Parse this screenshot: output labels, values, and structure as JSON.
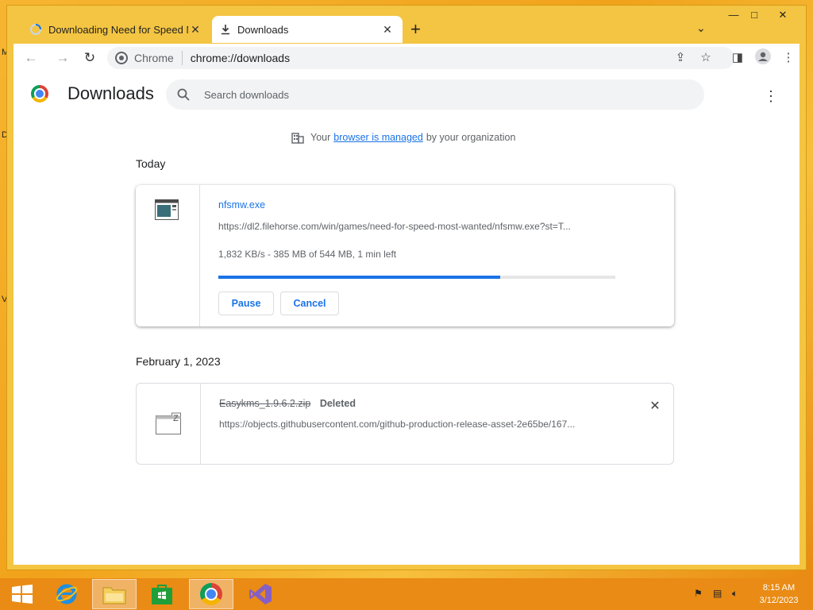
{
  "desktop": {
    "letters": [
      "M",
      "D",
      "V"
    ]
  },
  "browser": {
    "tabs": [
      {
        "title": "Downloading Need for Speed Most Wanted",
        "active": false
      },
      {
        "title": "Downloads",
        "active": true
      }
    ],
    "window_controls": {
      "minimize": "—",
      "maximize": "□",
      "close": "✕"
    },
    "toolbar": {
      "site_label": "Chrome",
      "url": "chrome://downloads"
    }
  },
  "downloads_page": {
    "title": "Downloads",
    "search": {
      "placeholder": "Search downloads",
      "value": ""
    },
    "managed_notice": {
      "prefix": "Your",
      "link": "browser is managed",
      "suffix": "by your organization"
    },
    "groups": [
      {
        "date": "Today",
        "item": {
          "file_name": "nfsmw.exe",
          "url": "https://dl2.filehorse.com/win/games/need-for-speed-most-wanted/nfsmw.exe?st=T...",
          "status": "1,832 KB/s - 385 MB of 544 MB, 1 min left",
          "progress": 0.71,
          "buttons": {
            "pause": "Pause",
            "cancel": "Cancel"
          }
        }
      },
      {
        "date": "February 1, 2023",
        "item": {
          "file_name": "Easykms_1.9.6.2.zip",
          "state": "Deleted",
          "url": "https://objects.githubusercontent.com/github-production-release-asset-2e65be/167..."
        }
      }
    ]
  },
  "taskbar": {
    "clock_time": "8:15 AM",
    "clock_date": "3/12/2023",
    "apps": [
      "start",
      "internet-explorer",
      "file-explorer",
      "store",
      "chrome",
      "visual-studio"
    ]
  },
  "colors": {
    "accent": "#1a73e8",
    "desktop": "#f1a21b",
    "taskbar": "#e98b15"
  }
}
